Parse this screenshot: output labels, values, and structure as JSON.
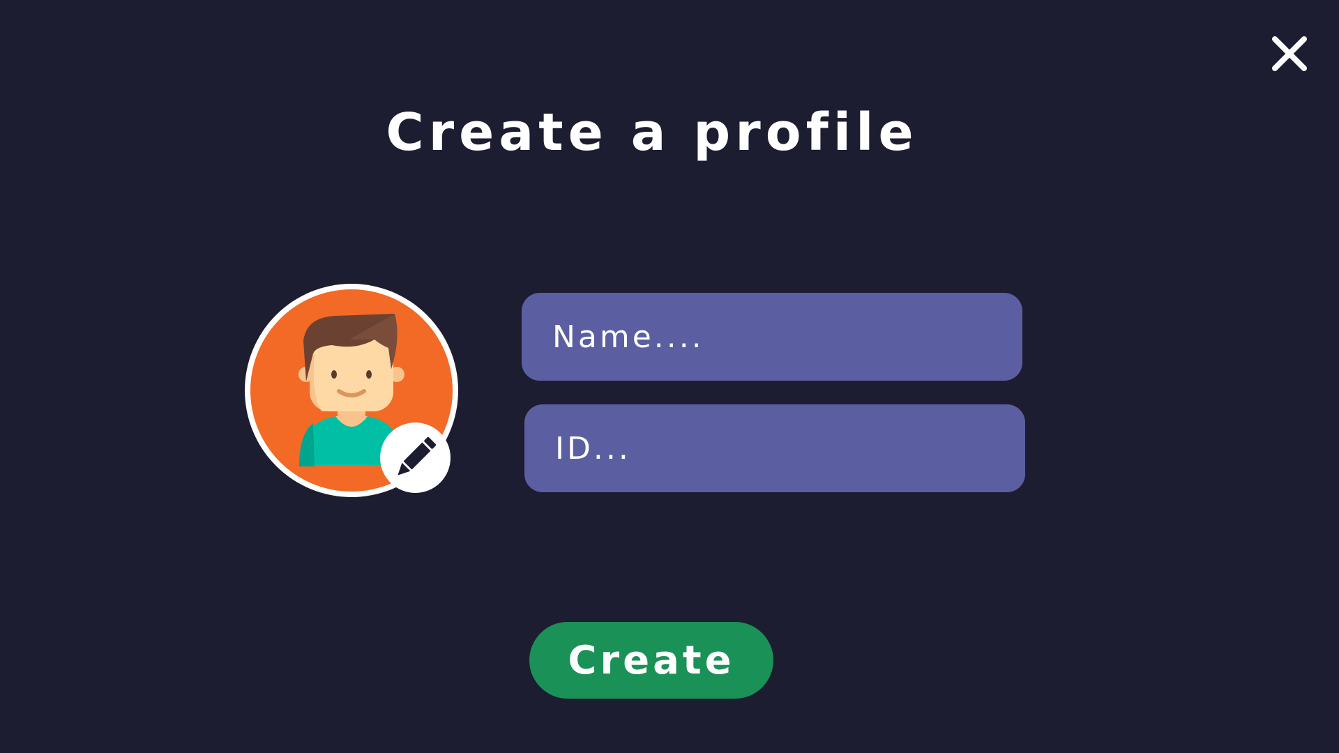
{
  "dialog": {
    "title": "Create a profile",
    "close_icon": "close-icon"
  },
  "avatar": {
    "icon": "user-avatar-icon",
    "edit_icon": "pencil-icon",
    "colors": {
      "background": "#f26a26",
      "hair": "#5f3a2b",
      "skin": "#fed9a6",
      "shirt": "#00bfa5"
    }
  },
  "form": {
    "name_placeholder": "Name....",
    "id_placeholder": "ID..."
  },
  "actions": {
    "create_label": "Create"
  },
  "theme": {
    "background": "#1d1d31",
    "field": "#5b5fa2",
    "button": "#1a9157",
    "text": "#ffffff"
  }
}
